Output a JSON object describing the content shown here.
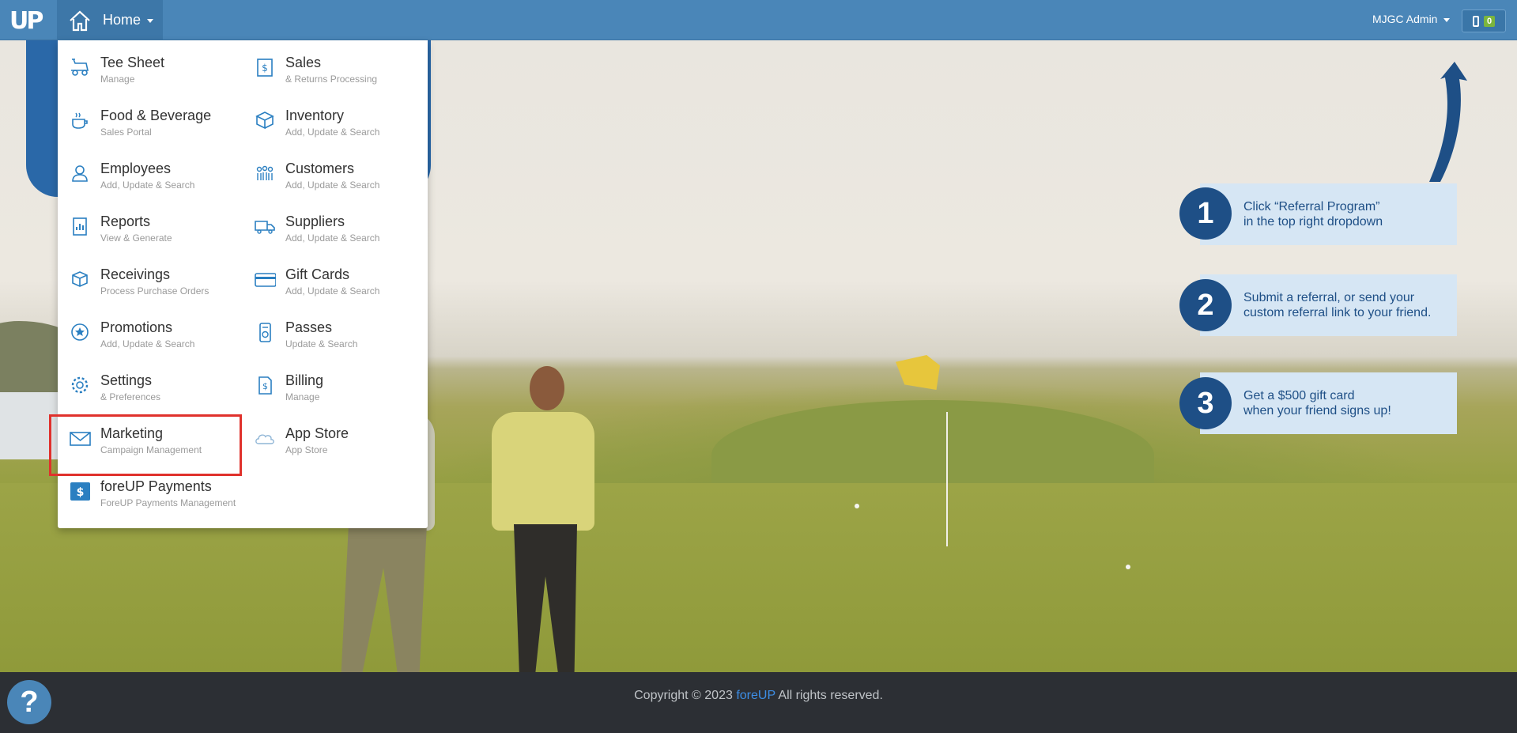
{
  "header": {
    "logo_text": "UP",
    "home_label": "Home",
    "user_label": "MJGC Admin",
    "register_count": "0"
  },
  "menu": {
    "items": [
      {
        "label": "Tee Sheet",
        "sub": "Manage",
        "icon": "golf-cart-icon"
      },
      {
        "label": "Sales",
        "sub": "& Returns Processing",
        "icon": "receipt-icon"
      },
      {
        "label": "Food & Beverage",
        "sub": "Sales Portal",
        "icon": "coffee-cup-icon"
      },
      {
        "label": "Inventory",
        "sub": "Add, Update & Search",
        "icon": "box-icon"
      },
      {
        "label": "Employees",
        "sub": "Add, Update & Search",
        "icon": "employee-icon"
      },
      {
        "label": "Customers",
        "sub": "Add, Update & Search",
        "icon": "customers-icon"
      },
      {
        "label": "Reports",
        "sub": "View & Generate",
        "icon": "report-icon"
      },
      {
        "label": "Suppliers",
        "sub": "Add, Update & Search",
        "icon": "truck-icon"
      },
      {
        "label": "Receivings",
        "sub": "Process Purchase Orders",
        "icon": "package-icon"
      },
      {
        "label": "Gift Cards",
        "sub": "Add, Update & Search",
        "icon": "credit-card-icon"
      },
      {
        "label": "Promotions",
        "sub": "Add, Update & Search",
        "icon": "star-icon"
      },
      {
        "label": "Passes",
        "sub": "Update & Search",
        "icon": "pass-icon"
      },
      {
        "label": "Settings",
        "sub": "& Preferences",
        "icon": "gear-icon"
      },
      {
        "label": "Billing",
        "sub": "Manage",
        "icon": "billing-icon"
      },
      {
        "label": "Marketing",
        "sub": "Campaign Management",
        "icon": "envelope-icon"
      },
      {
        "label": "App Store",
        "sub": "App Store",
        "icon": "cloud-icon"
      },
      {
        "label": "foreUP Payments",
        "sub": "ForeUP Payments Management",
        "icon": "dollar-icon"
      }
    ]
  },
  "referral": {
    "steps": [
      {
        "num": "1",
        "line1": "Click “Referral Program”",
        "line2": "in the top right dropdown"
      },
      {
        "num": "2",
        "line1": "Submit a referral, or send your",
        "line2": "custom referral link to your friend."
      },
      {
        "num": "3",
        "line1": "Get a $500 gift card",
        "line2": "when your friend signs up!"
      }
    ]
  },
  "footer": {
    "copyright_prefix": "Copyright © 2023 ",
    "brand": "foreUP",
    "copyright_suffix": " All rights reserved.",
    "help_label": "?"
  },
  "colors": {
    "header_bg": "#4a86b8",
    "icon_blue": "#2a7fc1",
    "highlight_red": "#e0312c",
    "referral_navy": "#1e4f86"
  }
}
